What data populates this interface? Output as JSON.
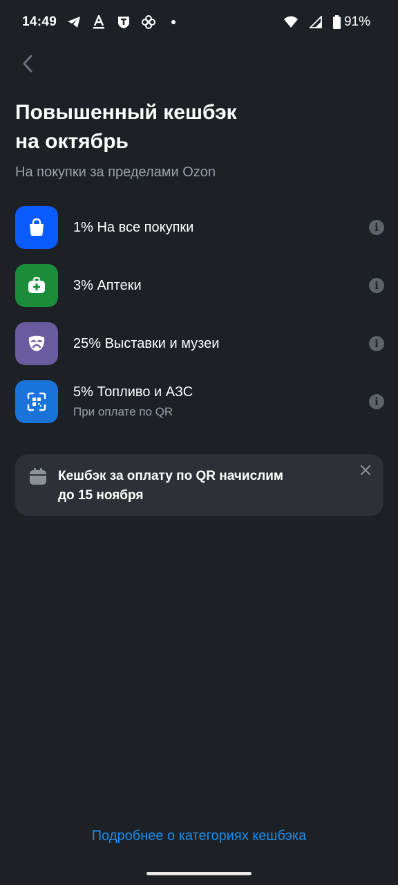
{
  "status_bar": {
    "time": "14:49",
    "battery": "91%",
    "icons": [
      "telegram-icon",
      "font-a-icon",
      "tinkoff-icon",
      "flower-icon",
      "dot-icon",
      "wifi-icon",
      "signal-icon",
      "battery-icon"
    ]
  },
  "header": {
    "title_line1": "Повышенный кешбэк",
    "title_line2": "на октябрь",
    "subtitle": "На покупки за пределами Ozon"
  },
  "categories": [
    {
      "label": "1% На все покупки",
      "sub": "",
      "icon": "shopping-bag-icon",
      "color": "#0c5bff"
    },
    {
      "label": "3% Аптеки",
      "sub": "",
      "icon": "first-aid-kit-icon",
      "color": "#1a8c3a"
    },
    {
      "label": "25% Выставки и музеи",
      "sub": "",
      "icon": "theater-mask-icon",
      "color": "#6a5a9e"
    },
    {
      "label": "5% Топливо и АЗС",
      "sub": "При оплате по QR",
      "icon": "qr-scan-icon",
      "color": "#1a73d8"
    }
  ],
  "notice": {
    "line1": "Кешбэк за оплату по QR начислим",
    "line2": "до 15 ноября"
  },
  "footer": {
    "more_link": "Подробнее о категориях кешбэка"
  },
  "colors": {
    "background": "#1d2025",
    "card": "#2d3036",
    "link": "#1e8ce8",
    "secondary_text": "#9aa0a8"
  }
}
